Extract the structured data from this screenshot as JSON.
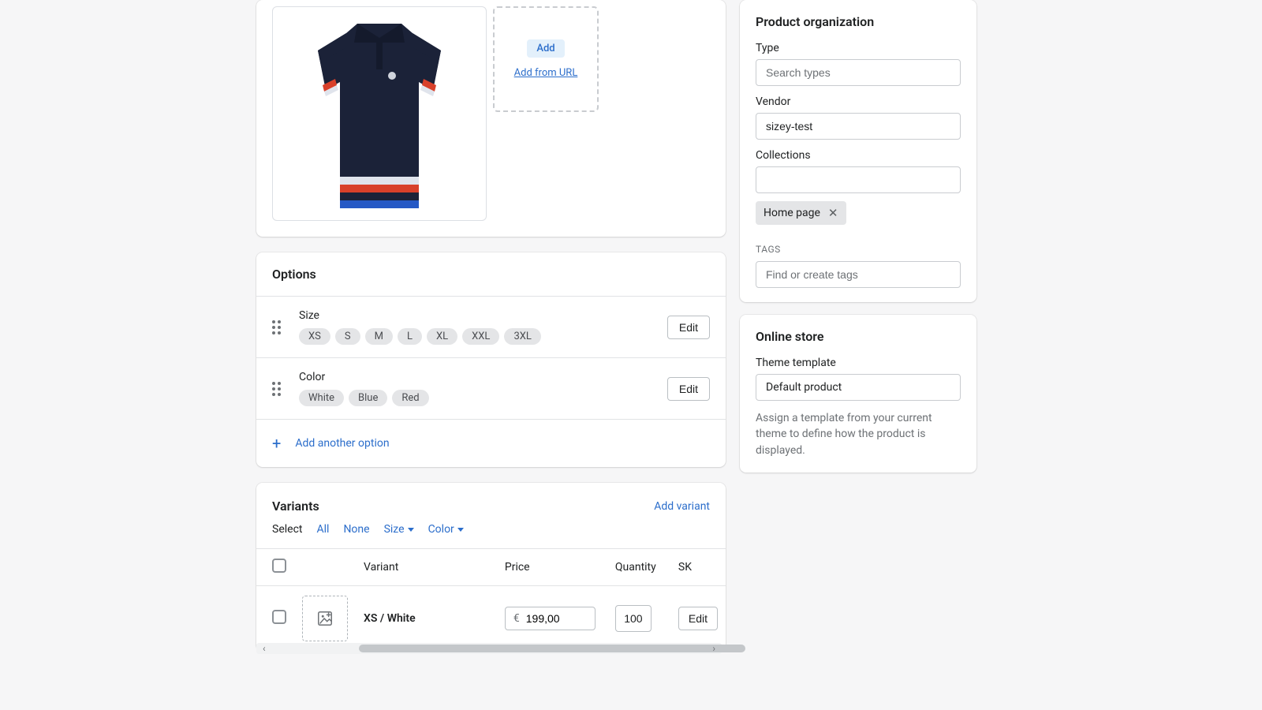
{
  "media": {
    "add_label": "Add",
    "add_url_label": "Add from URL"
  },
  "options": {
    "title": "Options",
    "add_another": "Add another option",
    "edit_label": "Edit",
    "list": [
      {
        "name": "Size",
        "values": [
          "XS",
          "S",
          "M",
          "L",
          "XL",
          "XXL",
          "3XL"
        ]
      },
      {
        "name": "Color",
        "values": [
          "White",
          "Blue",
          "Red"
        ]
      }
    ]
  },
  "variants": {
    "title": "Variants",
    "add_variant": "Add variant",
    "select_label": "Select",
    "filters": {
      "all": "All",
      "none": "None",
      "size": "Size",
      "color": "Color"
    },
    "columns": {
      "variant": "Variant",
      "price": "Price",
      "quantity": "Quantity",
      "sku": "SK"
    },
    "currency": "€",
    "edit_label": "Edit",
    "rows": [
      {
        "name": "XS / White",
        "price": "199,00",
        "quantity": "100"
      }
    ]
  },
  "org": {
    "title": "Product organization",
    "type_label": "Type",
    "type_placeholder": "Search types",
    "vendor_label": "Vendor",
    "vendor_value": "sizey-test",
    "collections_label": "Collections",
    "collections_value": "",
    "collection_chip": "Home page",
    "tags_label": "TAGS",
    "tags_placeholder": "Find or create tags"
  },
  "online": {
    "title": "Online store",
    "template_label": "Theme template",
    "template_value": "Default product",
    "helper": "Assign a template from your current theme to define how the product is displayed."
  }
}
